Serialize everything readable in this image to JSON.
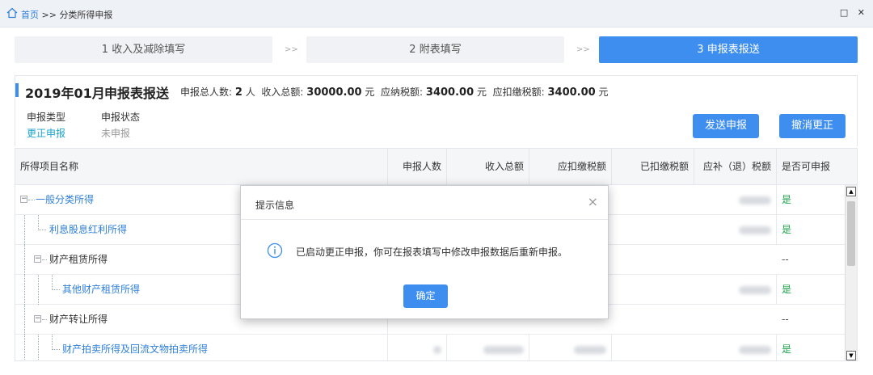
{
  "breadcrumb": {
    "home": "首页",
    "separator": ">>",
    "current": "分类所得申报"
  },
  "window": {
    "restore_glyph": "□",
    "close_glyph": "✕"
  },
  "steps": [
    {
      "label": "1 收入及减除填写"
    },
    {
      "label": "2 附表填写"
    },
    {
      "label": "3 申报表报送"
    }
  ],
  "step_separator": ">>",
  "summary": {
    "period": "2019年01月",
    "title": "申报表报送",
    "people_label": "申报总人数:",
    "people_value": "2",
    "people_unit": "人",
    "income_label": "收入总额:",
    "income_value": "30000.00",
    "income_unit": "元",
    "tax_label": "应纳税额:",
    "tax_value": "3400.00",
    "tax_unit": "元",
    "withhold_label": "应扣缴税额:",
    "withhold_value": "3400.00",
    "withhold_unit": "元",
    "type_label": "申报类型",
    "type_value": "更正申报",
    "status_label": "申报状态",
    "status_value": "未申报",
    "send_button": "发送申报",
    "cancel_button": "撤消更正"
  },
  "table": {
    "columns": [
      "所得项目名称",
      "申报人数",
      "收入总额",
      "应扣缴税额",
      "已扣缴税额",
      "应补（退）税额",
      "是否可申报"
    ],
    "rows": [
      {
        "name": "一般分类所得",
        "level": 0,
        "link": true,
        "can_declare": "是"
      },
      {
        "name": "利息股息红利所得",
        "level": 1,
        "link": true,
        "can_declare": "是"
      },
      {
        "name": "财产租赁所得",
        "level": 1,
        "link": false,
        "can_declare": "--"
      },
      {
        "name": "其他财产租赁所得",
        "level": 2,
        "link": true,
        "can_declare": "是"
      },
      {
        "name": "财产转让所得",
        "level": 1,
        "link": false,
        "can_declare": "--"
      },
      {
        "name": "财产拍卖所得及回流文物拍卖所得",
        "level": 2,
        "link": true,
        "can_declare": "是"
      }
    ]
  },
  "dialog": {
    "title": "提示信息",
    "close_glyph": "×",
    "message": "已启动更正申报，你可在报表填写中修改申报数据后重新申报。",
    "ok_button": "确定"
  },
  "colors": {
    "accent": "#3e8ef0",
    "link": "#2f7fd8",
    "yes": "#1aa34a",
    "correction": "#1aa3c9"
  }
}
